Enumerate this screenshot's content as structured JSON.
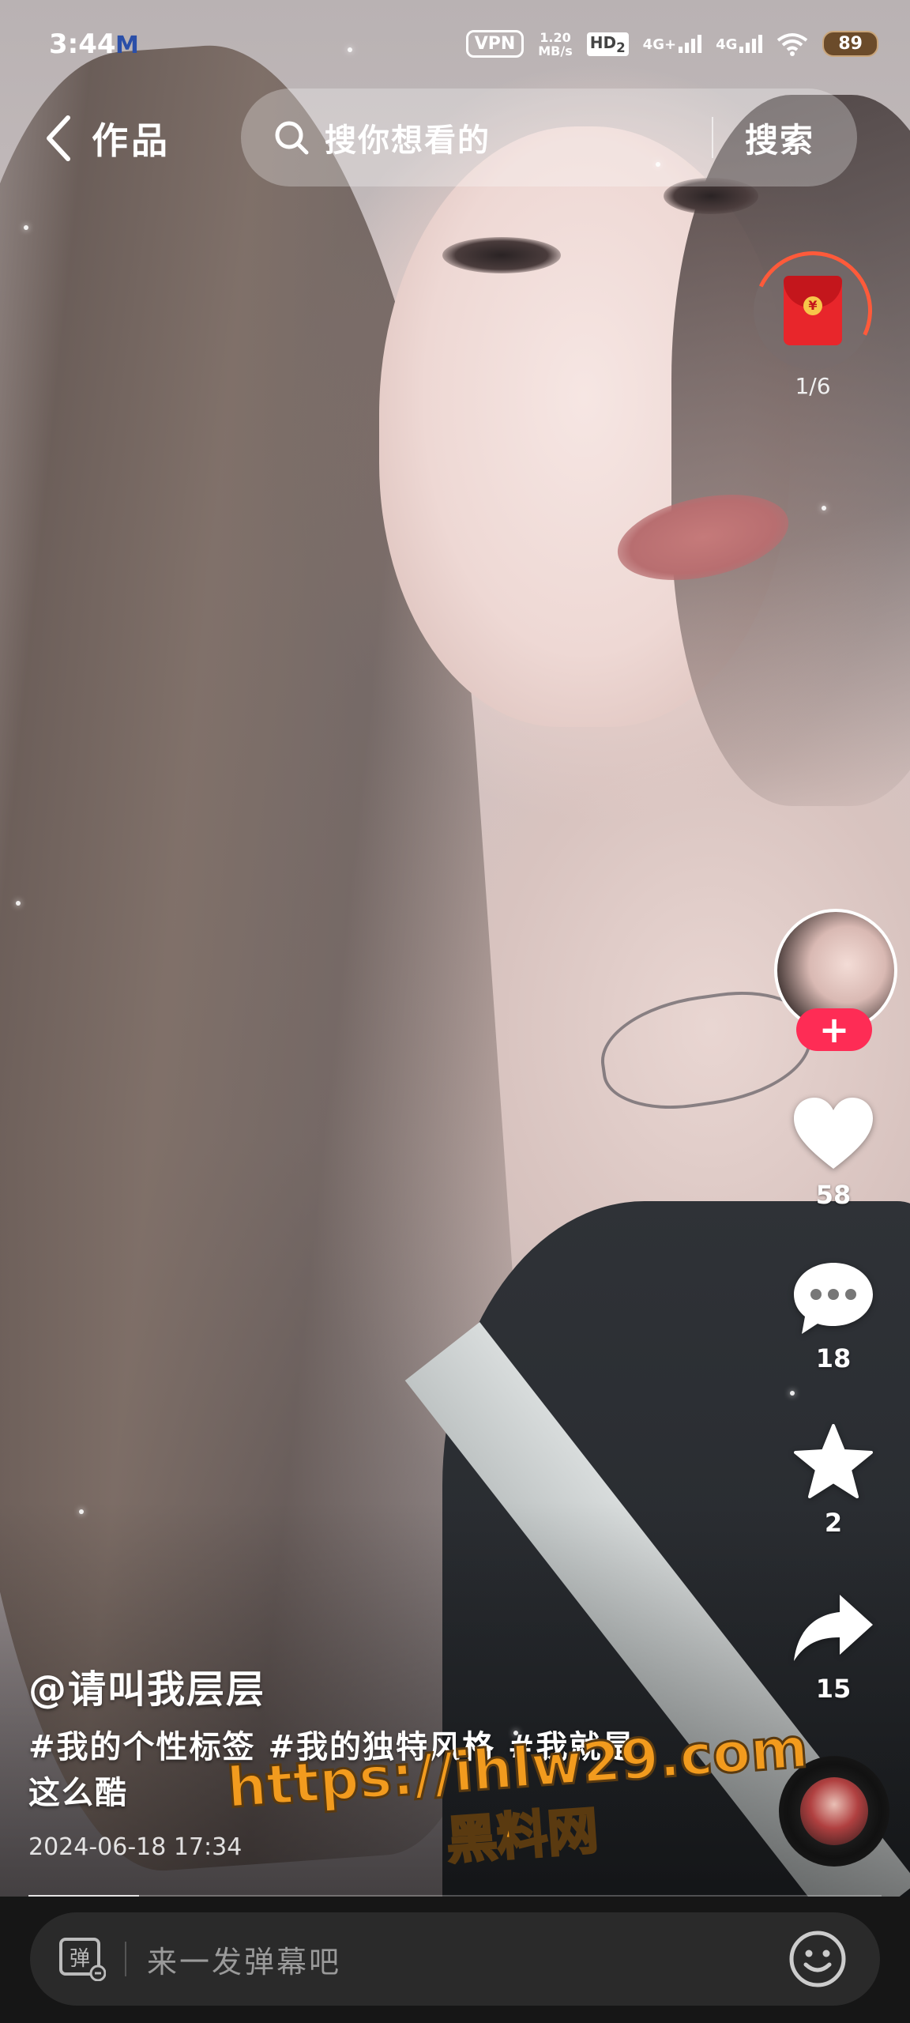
{
  "status_bar": {
    "time": "3:44",
    "mail_glyph": "M",
    "vpn_label": "VPN",
    "speed_value": "1.20",
    "speed_unit": "MB/s",
    "hd_label": "HD",
    "hd_sub": "2",
    "net1_label": "4G+",
    "net2_label": "4G",
    "battery_level": "89"
  },
  "header": {
    "title": "作品",
    "search_placeholder": "搜你想看的",
    "search_button": "搜索"
  },
  "red_packet": {
    "count": "1/6",
    "coin_glyph": "¥"
  },
  "actions": {
    "follow_glyph": "+",
    "likes": "58",
    "comments": "18",
    "favorites": "2",
    "shares": "15"
  },
  "video": {
    "author": "@请叫我层层",
    "description": "#我的个性标签 #我的独特风格 #我就是这么酷",
    "date": "2024-06-18 17:34",
    "progress": 0.13
  },
  "watermark": {
    "url": "https://ihlw29.com",
    "name": "黑料网"
  },
  "bottom_bar": {
    "danmu_placeholder": "来一发弹幕吧",
    "danmu_glyph": "弹"
  },
  "colors": {
    "accent": "#fe2c55",
    "red_packet": "#e8262b",
    "watermark": "#f29b1e"
  }
}
